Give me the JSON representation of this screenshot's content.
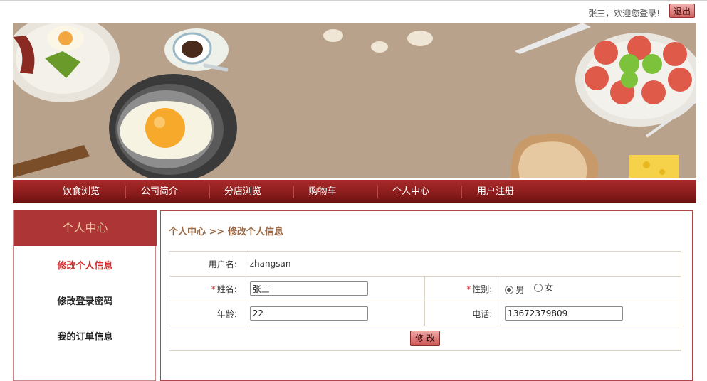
{
  "header": {
    "welcome_text": "张三，欢迎您登录!",
    "logout_label": "退出"
  },
  "nav": {
    "items": [
      {
        "label": "饮食浏览"
      },
      {
        "label": "公司简介"
      },
      {
        "label": "分店浏览"
      },
      {
        "label": "购物车"
      },
      {
        "label": "个人中心"
      },
      {
        "label": "用户注册"
      }
    ]
  },
  "sidebar": {
    "title": "个人中心",
    "links": [
      {
        "label": "修改个人信息",
        "active": true
      },
      {
        "label": "修改登录密码",
        "active": false
      },
      {
        "label": "我的订单信息",
        "active": false
      }
    ]
  },
  "main": {
    "breadcrumb": "个人中心 >> 修改个人信息",
    "form": {
      "username_label": "用户名:",
      "username_value": "zhangsan",
      "name_label": "姓名:",
      "name_value": "张三",
      "gender_label": "性别:",
      "gender_options": [
        "男",
        "女"
      ],
      "gender_selected": "男",
      "age_label": "年龄:",
      "age_value": "22",
      "phone_label": "电话:",
      "phone_value": "13672379809",
      "required_mark": "*",
      "submit_label": "修 改"
    }
  },
  "colors": {
    "nav_bg": "#8c1d1d",
    "sidebar_head_bg": "#ad3535",
    "active_link": "#d22c2c",
    "banner_bg": "#b9a28b"
  }
}
